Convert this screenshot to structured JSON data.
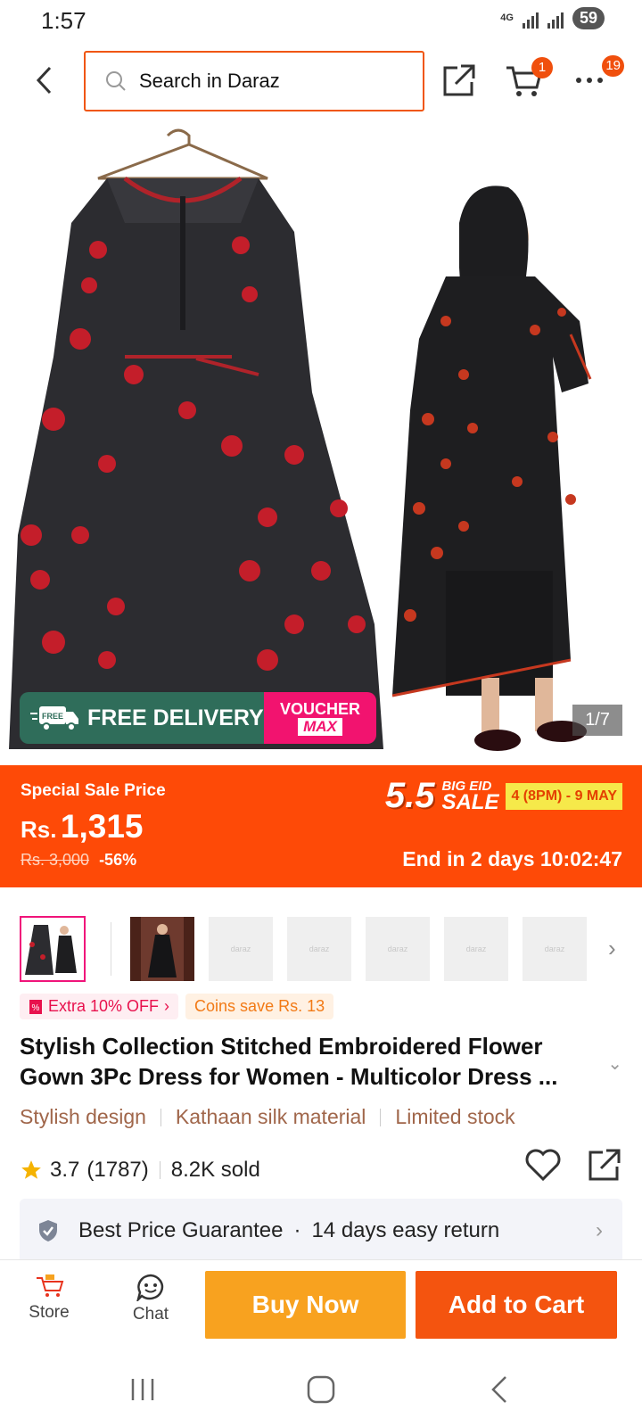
{
  "status_bar": {
    "time": "1:57",
    "network": "4G",
    "battery": "59"
  },
  "header": {
    "search_placeholder": "Search in Daraz",
    "cart_badge": "1",
    "more_badge": "19"
  },
  "gallery": {
    "counter": "1/7",
    "promo_free_label": "FREE",
    "promo_delivery": "FREE DELIVERY",
    "promo_voucher": "VOUCHER",
    "promo_max": "MAX"
  },
  "sale": {
    "label": "Special Sale Price",
    "currency": "Rs.",
    "price": "1,315",
    "original_price": "Rs. 3,000",
    "discount": "-56%",
    "campaign_number": "5.5",
    "campaign_big": "BIG EID",
    "campaign_sale": "SALE",
    "campaign_dates": "4 (8PM) - 9 MAY",
    "countdown": "End in 2 days 10:02:47"
  },
  "thumbnails": {
    "placeholder_text": "daraz",
    "count": 7
  },
  "tags": {
    "extra_off": "Extra 10% OFF",
    "coins": "Coins save Rs. 13"
  },
  "product": {
    "title": "Stylish Collection Stitched Embroidered Flower Gown 3Pc Dress for Women - Multicolor Dress ...",
    "highlights": [
      "Stylish design",
      "Kathaan silk material",
      "Limited stock"
    ],
    "rating": "3.7",
    "reviews": "(1787)",
    "sold": "8.2K sold"
  },
  "guarantee": {
    "best_price": "Best Price Guarantee",
    "separator": "·",
    "return_policy": "14 days easy return"
  },
  "bottom_bar": {
    "store_label": "Store",
    "chat_label": "Chat",
    "buy_now": "Buy Now",
    "add_to_cart": "Add to Cart"
  },
  "colors": {
    "accent": "#f4540f",
    "sale_band": "#fe4a07",
    "buy_now": "#f8a21f",
    "highlight_text": "#a0664a"
  }
}
